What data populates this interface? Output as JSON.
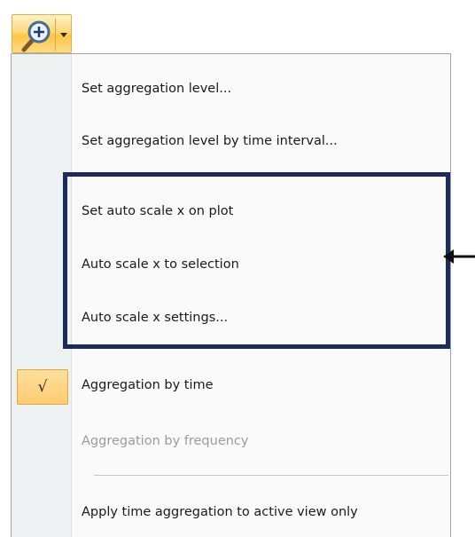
{
  "toolbar": {
    "zoom_button": {
      "icon": "magnifier-zoom-in-icon",
      "dropdown_icon": "dropdown-arrow-icon"
    }
  },
  "menu": {
    "items": [
      {
        "label": "Set aggregation level...",
        "enabled": true,
        "checked": false
      },
      {
        "label": "Set aggregation level by time interval...",
        "enabled": true,
        "checked": false
      },
      {
        "label": "Set auto scale x on plot",
        "enabled": true,
        "checked": false
      },
      {
        "label": "Auto scale x to selection",
        "enabled": true,
        "checked": false
      },
      {
        "label": "Auto scale x settings...",
        "enabled": true,
        "checked": false
      },
      {
        "label": "Aggregation by time",
        "enabled": true,
        "checked": true
      },
      {
        "label": "Aggregation by frequency",
        "enabled": false,
        "checked": false
      },
      {
        "label": "Apply time aggregation to active view only",
        "enabled": true,
        "checked": false
      }
    ],
    "check_glyph": "√"
  },
  "colors": {
    "highlight_frame": "#1b2c58",
    "button_accent": "#ffc644",
    "disabled_text": "#9b9b9b"
  }
}
